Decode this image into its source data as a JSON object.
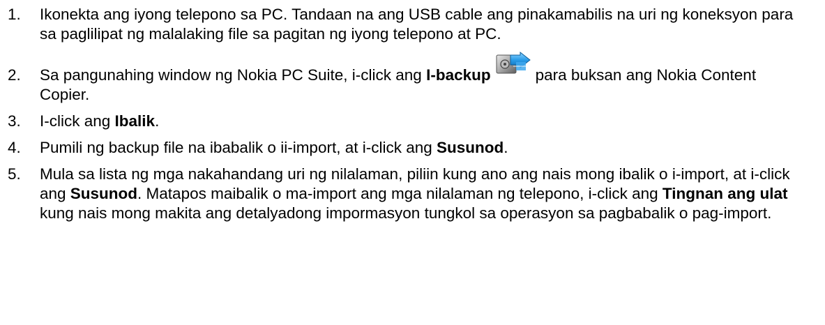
{
  "steps": [
    {
      "number": "1.",
      "text": "Ikonekta ang iyong telepono sa PC. Tandaan na ang USB cable ang pinakamabilis na uri ng koneksyon para sa paglilipat ng malalaking file sa pagitan ng iyong telepono at PC."
    },
    {
      "number": "2.",
      "before": "Sa pangunahing window ng Nokia PC Suite, i-click ang ",
      "bold": "I-backup",
      "icon": "backup-restore-icon",
      "after": "para buksan ang Nokia Content Copier."
    },
    {
      "number": "3.",
      "before": "I-click ang ",
      "bold": "Ibalik",
      "after": "."
    },
    {
      "number": "4.",
      "before": "Pumili ng backup file na ibabalik o ii-import, at i-click ang ",
      "bold": "Susunod",
      "after": "."
    },
    {
      "number": "5.",
      "before": "Mula sa lista ng mga nakahandang uri ng nilalaman, piliin kung ano ang nais mong ibalik o i-import, at i-click ang ",
      "bold": "Susunod",
      "middle": ". Matapos maibalik o ma-import ang mga nilalaman ng telepono, i-click ang ",
      "bold2": "Tingnan ang ulat",
      "after": " kung nais mong makita ang detalyadong impormasyon tungkol sa operasyon sa pagbabalik o pag-import."
    }
  ]
}
